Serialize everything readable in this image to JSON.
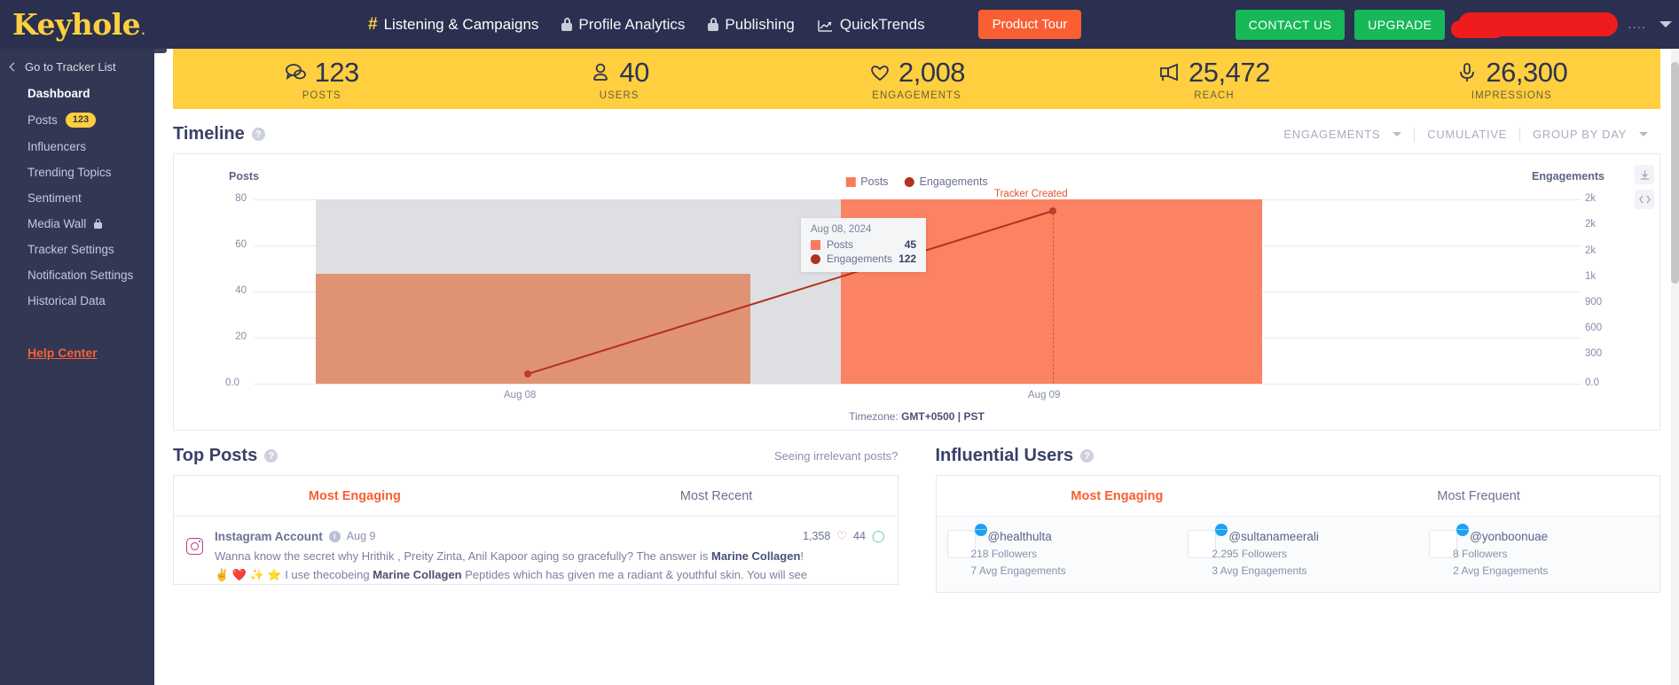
{
  "brand": {
    "name": "Keyhole",
    "registered": "."
  },
  "topnav": {
    "links": [
      {
        "label": "Listening & Campaigns",
        "icon": "hash-icon",
        "active": true
      },
      {
        "label": "Profile Analytics",
        "icon": "lock-icon",
        "active": false
      },
      {
        "label": "Publishing",
        "icon": "lock-icon",
        "active": false
      },
      {
        "label": "QuickTrends",
        "icon": "trend-chart-icon",
        "active": false
      }
    ],
    "product_tour": "Product Tour",
    "contact_us": "CONTACT US",
    "upgrade": "UPGRADE",
    "overflow_dots": "....",
    "accent_orange": "#fa5f33",
    "accent_green": "#17b857",
    "brand_yellow": "#ffcf3f",
    "nav_bg": "#2b3050"
  },
  "sidebar": {
    "back_label": "Go to Tracker List",
    "items": [
      {
        "label": "Dashboard",
        "active": true,
        "badge": null,
        "locked": false
      },
      {
        "label": "Posts",
        "active": false,
        "badge": "123",
        "locked": false
      },
      {
        "label": "Influencers",
        "active": false,
        "badge": null,
        "locked": false
      },
      {
        "label": "Trending Topics",
        "active": false,
        "badge": null,
        "locked": false
      },
      {
        "label": "Sentiment",
        "active": false,
        "badge": null,
        "locked": false
      },
      {
        "label": "Media Wall",
        "active": false,
        "badge": null,
        "locked": true
      },
      {
        "label": "Tracker Settings",
        "active": false,
        "badge": null,
        "locked": false
      },
      {
        "label": "Notification Settings",
        "active": false,
        "badge": null,
        "locked": false
      },
      {
        "label": "Historical Data",
        "active": false,
        "badge": null,
        "locked": false
      }
    ],
    "help_center": "Help Center"
  },
  "metrics": [
    {
      "value": "123",
      "label": "POSTS",
      "icon": "comments-icon"
    },
    {
      "value": "40",
      "label": "USERS",
      "icon": "user-icon"
    },
    {
      "value": "2,008",
      "label": "ENGAGEMENTS",
      "icon": "heart-icon"
    },
    {
      "value": "25,472",
      "label": "REACH",
      "icon": "megaphone-icon"
    },
    {
      "value": "26,300",
      "label": "IMPRESSIONS",
      "icon": "microphone-icon"
    }
  ],
  "timeline": {
    "title": "Timeline",
    "controls": {
      "metric": "ENGAGEMENTS",
      "cumulative": "CUMULATIVE",
      "group_by": "GROUP BY DAY"
    },
    "timezone": "Timezone: ",
    "timezone_value": "GMT+0500 | PST",
    "marker_label": "Tracker Created",
    "tooltip": {
      "date": "Aug 08, 2024",
      "rows": [
        {
          "name": "Posts",
          "value": "45"
        },
        {
          "name": "Engagements",
          "value": "122"
        }
      ]
    }
  },
  "chart_data": {
    "type": "bar",
    "title": "Timeline",
    "xlabel": "",
    "ylabel": "Posts",
    "y2label": "Engagements",
    "categories": [
      "Aug 08",
      "Aug 09"
    ],
    "series": [
      {
        "name": "Posts",
        "type": "bar",
        "axis": "left",
        "values": [
          45,
          78
        ],
        "color": "#e09274"
      },
      {
        "name": "Engagements",
        "type": "line",
        "axis": "right",
        "values": [
          122,
          2008
        ],
        "color": "#b3311f"
      }
    ],
    "ylim": [
      0,
      80
    ],
    "yticks": [
      "0.0",
      "20",
      "40",
      "60",
      "80"
    ],
    "y2ticks": [
      "0.0",
      "300",
      "600",
      "900",
      "1k",
      "2k",
      "2k",
      "2k"
    ],
    "grid": true,
    "legend": [
      "Posts",
      "Engagements"
    ],
    "legend_position": "top-center",
    "annotations": [
      {
        "text": "Tracker Created",
        "x": "Aug 09",
        "color": "#e0532f"
      }
    ]
  },
  "top_posts": {
    "title": "Top Posts",
    "link": "Seeing irrelevant posts?",
    "tabs": [
      {
        "label": "Most Engaging",
        "active": true
      },
      {
        "label": "Most Recent",
        "active": false
      }
    ],
    "post": {
      "platform_icon": "instagram-icon",
      "author": "Instagram Account",
      "date": "Aug 9",
      "likes": "1,358",
      "comments": "44",
      "line1_a": "Wanna know the secret why Hrithik , Preity Zinta, Anil Kapoor aging so gracefully? The answer is ",
      "line1_b": "Marine Collagen",
      "line1_c": "!",
      "line2_a": "✌️ ❤️ ✨ ⭐ I use thecobeing ",
      "line2_b": "Marine Collagen",
      "line2_c": " Peptides which has given me a radiant & youthful skin. You will see"
    }
  },
  "influential_users": {
    "title": "Influential Users",
    "tabs": [
      {
        "label": "Most Engaging",
        "active": true
      },
      {
        "label": "Most Frequent",
        "active": false
      }
    ],
    "users": [
      {
        "handle": "@healthulta",
        "followers": "218 Followers",
        "engagements": "7 Avg Engagements",
        "platform": "twitter-icon"
      },
      {
        "handle": "@sultanameerali",
        "followers": "2,295 Followers",
        "engagements": "3 Avg Engagements",
        "platform": "twitter-icon"
      },
      {
        "handle": "@yonboonuae",
        "followers": "8 Followers",
        "engagements": "2 Avg Engagements",
        "platform": "twitter-icon"
      }
    ]
  }
}
